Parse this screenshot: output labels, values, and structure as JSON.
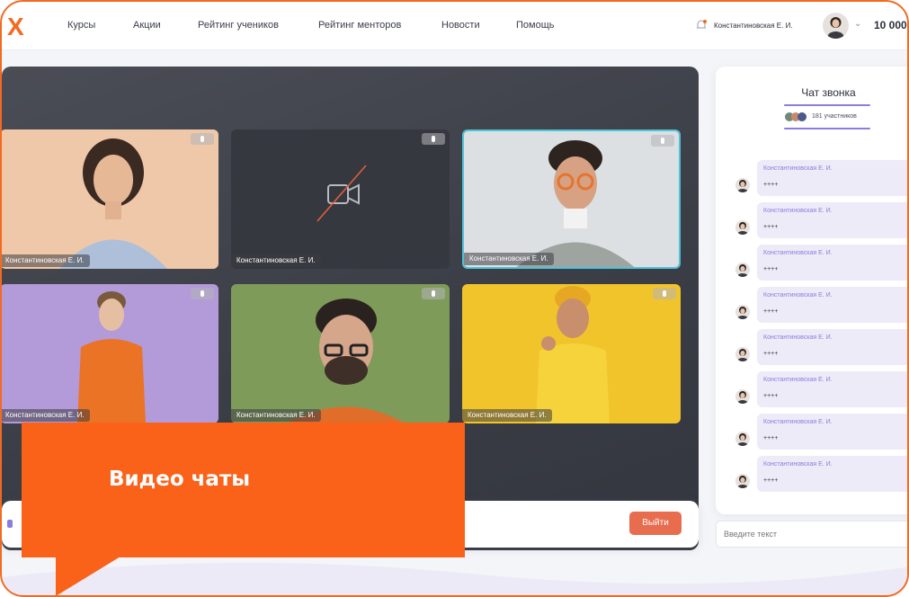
{
  "nav": {
    "logo": "X",
    "items": [
      "Курсы",
      "Акции",
      "Рейтинг учеников",
      "Рейтинг менторов",
      "Новости",
      "Помощь"
    ],
    "user_name": "Константиновская Е. И.",
    "balance": "10 000"
  },
  "video": {
    "tiles": [
      {
        "label": "Константиновская Е. И."
      },
      {
        "label": "Константиновская Е. И."
      },
      {
        "label": "Константиновская Е. И."
      },
      {
        "label": "Константиновская Е. И."
      },
      {
        "label": "Константиновская Е. И."
      },
      {
        "label": "Константиновская Е. И."
      }
    ],
    "exit_label": "Выйти"
  },
  "chat": {
    "title": "Чат звонка",
    "participants": "181 участников",
    "messages": [
      {
        "author": "Константиновская Е. И.",
        "text": "++++"
      },
      {
        "author": "Константиновская Е. И.",
        "text": "++++"
      },
      {
        "author": "Константиновская Е. И.",
        "text": "++++"
      },
      {
        "author": "Константиновская Е. И.",
        "text": "++++"
      },
      {
        "author": "Константиновская Е. И.",
        "text": "++++"
      },
      {
        "author": "Константиновская Е. И.",
        "text": "++++"
      },
      {
        "author": "Константиновская Е. И.",
        "text": "++++"
      },
      {
        "author": "Константиновская Е. И.",
        "text": "++++"
      }
    ],
    "input_placeholder": "Введите текст"
  },
  "promo": {
    "text": "Видео чаты"
  },
  "colors": {
    "accent_orange": "#fa6119",
    "accent_purple": "#8a7de0",
    "exit_button": "#e86c4e",
    "active_tile_border": "#4fc3d9"
  }
}
